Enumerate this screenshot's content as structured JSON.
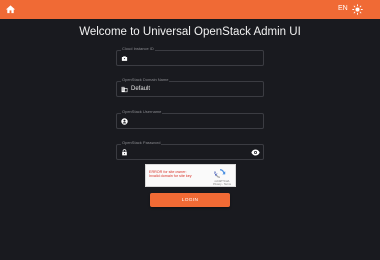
{
  "colors": {
    "accent": "#f06a35",
    "background": "#191a1f",
    "error": "#d93025"
  },
  "header": {
    "home_icon": "home-icon",
    "language": "EN",
    "theme_icon": "sun-icon"
  },
  "main": {
    "title": "Welcome to Universal OpenStack Admin UI"
  },
  "form": {
    "cloud_id": {
      "label": "Cloud Instance ID",
      "value": "",
      "icon": "briefcase-icon"
    },
    "domain": {
      "label": "OpenStack Domain Name",
      "value": "Default",
      "icon": "domain-icon"
    },
    "username": {
      "label": "OpenStack Username",
      "value": "",
      "icon": "user-icon"
    },
    "password": {
      "label": "OpenStack Password",
      "value": "",
      "icon": "lock-icon",
      "toggle_icon": "eye-icon"
    }
  },
  "captcha": {
    "error_lines": [
      "ERROR for site owner:",
      "Invalid domain for site key"
    ],
    "brand": "reCAPTCHA",
    "links": "Privacy - Terms"
  },
  "login_button": {
    "label": "LOGIN"
  }
}
